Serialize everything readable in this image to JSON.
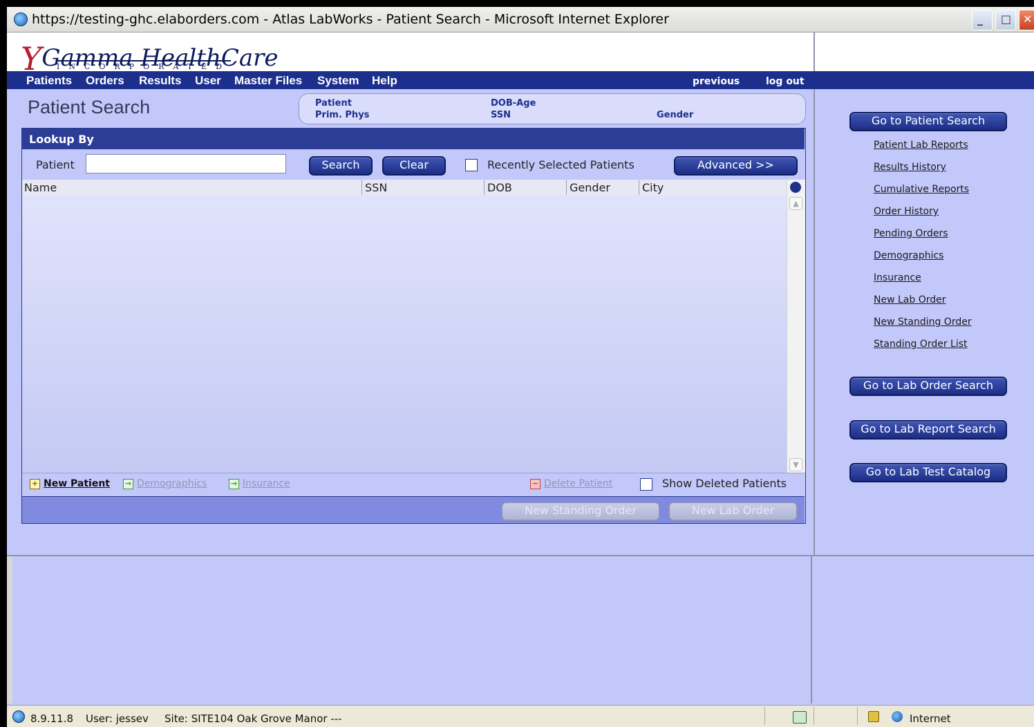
{
  "window": {
    "title": "https://testing-ghc.elaborders.com - Atlas LabWorks - Patient Search - Microsoft Internet Explorer"
  },
  "logo": {
    "initial": "Y",
    "name": "Gamma HealthCare",
    "sub": "INCORPORATED"
  },
  "menu": {
    "items": [
      "Patients",
      "Orders",
      "Results",
      "User",
      "Master Files",
      "System",
      "Help"
    ],
    "previous": "previous",
    "logout": "log out"
  },
  "page": {
    "title": "Patient Search"
  },
  "info": {
    "patient": "Patient",
    "prim_phys": "Prim. Phys",
    "dob_age": "DOB-Age",
    "ssn": "SSN",
    "gender": "Gender"
  },
  "lookup": {
    "header": "Lookup By",
    "patient_label": "Patient",
    "patient_value": "",
    "search": "Search",
    "clear": "Clear",
    "recent_label": "Recently Selected Patients",
    "advanced": "Advanced >>"
  },
  "grid": {
    "columns": [
      "Name",
      "SSN",
      "DOB",
      "Gender",
      "City"
    ],
    "rows": []
  },
  "footer": {
    "new_patient": "New Patient",
    "demographics": "Demographics",
    "insurance": "Insurance",
    "delete_patient": "Delete Patient",
    "show_deleted": "Show Deleted Patients",
    "new_standing_order": "New Standing Order",
    "new_lab_order": "New Lab Order"
  },
  "sidebar": {
    "go_patient_search": "Go to Patient Search",
    "links": [
      "Patient Lab Reports",
      "Results History",
      "Cumulative Reports",
      "Order History",
      "Pending Orders",
      "Demographics",
      "Insurance",
      "New Lab Order",
      "New Standing Order",
      "Standing Order List"
    ],
    "go_lab_order_search": "Go to Lab Order Search",
    "go_lab_report_search": "Go to Lab Report Search",
    "go_lab_test_catalog": "Go to Lab Test Catalog"
  },
  "status": {
    "version": "8.9.11.8",
    "user": "User: jessev",
    "site": "Site: SITE104  Oak Grove Manor ---",
    "zone": "Internet"
  },
  "colors": {
    "nav_blue": "#1d2f8c",
    "panel": "#c3c8fa",
    "accent_red": "#b2202e"
  }
}
